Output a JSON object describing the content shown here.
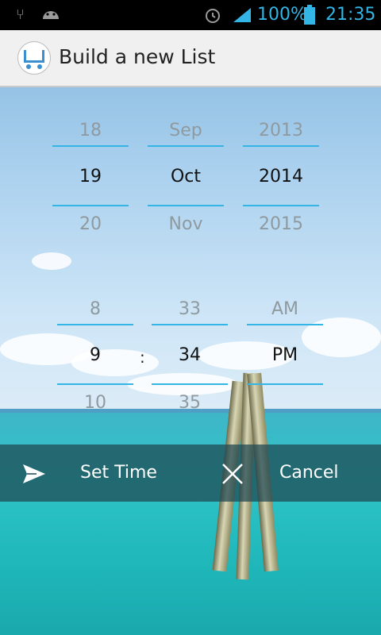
{
  "status_bar": {
    "battery": "100%",
    "time": "21:35",
    "icons": [
      "usb-icon",
      "android-icon",
      "alarm-icon",
      "signal-icon",
      "battery-icon"
    ]
  },
  "action_bar": {
    "title": "Build a new List",
    "icon": "shopping-cart-icon"
  },
  "date_picker": {
    "day": {
      "prev": "18",
      "current": "19",
      "next": "20"
    },
    "month": {
      "prev": "Sep",
      "current": "Oct",
      "next": "Nov"
    },
    "year": {
      "prev": "2013",
      "current": "2014",
      "next": "2015"
    }
  },
  "time_picker": {
    "hour": {
      "prev": "8",
      "current": "9",
      "next": "10"
    },
    "separator": ":",
    "minute": {
      "prev": "33",
      "current": "34",
      "next": "35"
    },
    "ampm": {
      "prev": "AM",
      "current": "PM"
    }
  },
  "actions": {
    "set_time_label": "Set Time",
    "set_time_icon": "send-icon",
    "cancel_label": "Cancel",
    "cancel_icon": "close-icon"
  },
  "colors": {
    "accent": "#33b5e5",
    "action_bar": "#f0f0f0",
    "bottom_bar": "#1e4650"
  }
}
